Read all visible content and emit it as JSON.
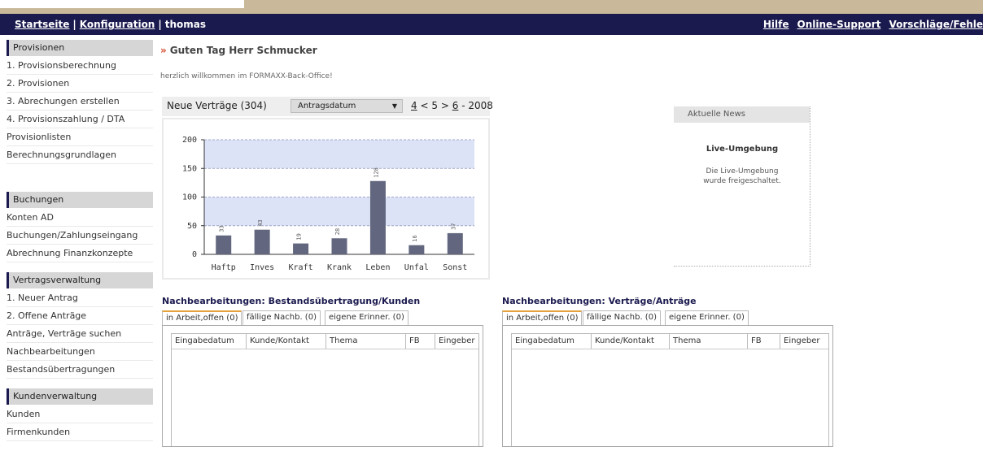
{
  "topbar": {
    "links_left": [
      "Startseite",
      "Konfiguration"
    ],
    "user": "thomas",
    "links_right": [
      "Hilfe",
      "Online-Support",
      "Vorschläge/Fehle"
    ]
  },
  "sidebar": {
    "groups": [
      {
        "title": "Provisionen",
        "items": [
          "1. Provisionsberechnung",
          "2. Provisionen",
          "3. Abrechungen erstellen",
          "4. Provisionszahlung / DTA",
          "Provisionlisten",
          "Berechnungsgrundlagen"
        ]
      },
      {
        "title": "Buchungen",
        "items": [
          "Konten AD",
          "Buchungen/Zahlungseingang",
          "Abrechnung Finanzkonzepte"
        ]
      },
      {
        "title": "Vertragsverwaltung",
        "items": [
          "1. Neuer Antrag",
          "2. Offene Anträge",
          "Anträge, Verträge suchen",
          "Nachbearbeitungen",
          "Bestandsübertragungen"
        ]
      },
      {
        "title": "Kundenverwaltung",
        "items": [
          "Kunden",
          "Firmenkunden"
        ]
      }
    ]
  },
  "greeting": "Guten Tag Herr Schmucker",
  "welcome": "herzlich willkommen im FORMAXX-Back-Office!",
  "chart_panel": {
    "title": "Neue Verträge (304)",
    "select_value": "Antragsdatum",
    "years": {
      "prev": "4",
      "lt": "<",
      "current": "5",
      "gt": ">",
      "next": "6",
      "dash": "-",
      "year": "2008"
    }
  },
  "chart_data": {
    "type": "bar",
    "categories": [
      "Haftp",
      "Inves",
      "Kraft",
      "Krank",
      "Leben",
      "Unfal",
      "Sonst"
    ],
    "values": [
      33,
      43,
      19,
      28,
      128,
      16,
      37
    ],
    "value_labels": [
      "33",
      "43",
      "19",
      "28",
      "128",
      "16",
      "37"
    ],
    "yticks": [
      "0",
      "50",
      "100",
      "150",
      "200"
    ],
    "ylim": [
      0,
      200
    ],
    "grid": true,
    "colors": {
      "bar": "#62677f",
      "band": "#dde3f7",
      "grid": "#9fa8c8"
    }
  },
  "news": {
    "header": "Aktuelle News",
    "title": "Live-Umgebung",
    "line1": "Die Live-Umgebung",
    "line2": "wurde freigeschaltet."
  },
  "nachbearbeitung_left": {
    "title": "Nachbearbeitungen: Bestandsübertragung/Kunden",
    "tabs": [
      "in Arbeit,offen (0)",
      "fällige Nachb. (0)",
      "eigene Erinner. (0)"
    ],
    "columns": [
      "Eingabedatum",
      "Kunde/Kontakt",
      "Thema",
      "FB",
      "Eingeber"
    ]
  },
  "nachbearbeitung_right": {
    "title": "Nachbearbeitungen: Verträge/Anträge",
    "tabs": [
      "in Arbeit,offen (0)",
      "fällige Nachb. (0)",
      "eigene Erinner. (0)"
    ],
    "columns": [
      "Eingabedatum",
      "Kunde/Kontakt",
      "Thema",
      "FB",
      "Eingeber"
    ]
  }
}
